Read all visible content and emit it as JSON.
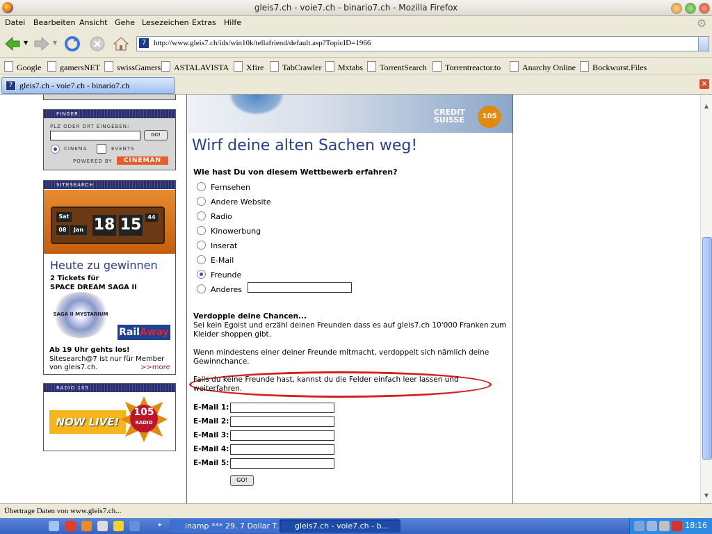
{
  "window": {
    "title": "gleis7.ch - voie7.ch - binario7.ch - Mozilla Firefox"
  },
  "menu": [
    "Datei",
    "Bearbeiten",
    "Ansicht",
    "Gehe",
    "Lesezeichen",
    "Extras",
    "Hilfe"
  ],
  "nav": {
    "url": "http://www.gleis7.ch/ids/win10k/tellafriend/default.asp?TopicID=1966",
    "favicon": "7"
  },
  "bookmarks": [
    "Google",
    "gamersNET",
    "swissGamers",
    "ASTALAVISTA",
    "Xfire",
    "TabCrawler",
    "Mxtabs",
    "TorrentSearch",
    "Torrentreactor.to",
    "Anarchy Online",
    "Bockwurst.Files"
  ],
  "tab": {
    "label": "gleis7.ch - voie7.ch - binario7.ch",
    "favicon": "7"
  },
  "sidebar": {
    "finder": {
      "header": "FINDER",
      "prompt": "PLZ ODER ORT EINGEBEN:",
      "go": "GO!",
      "cinema": "CINEMA",
      "events": "EVENTS",
      "powered": "POWERED BY",
      "brand": "CINEMAN"
    },
    "sitesearch": {
      "header": "SITESEARCH",
      "day": "Sat",
      "date": "08",
      "month": "Jan",
      "hour": "18",
      "minute": "15",
      "second": "44",
      "promo_title": "Heute zu gewinnen",
      "promo_line1": "2 Tickets für",
      "promo_line2": "SPACE DREAM SAGA II",
      "saga_label": "SAGA II MYSTARIUM",
      "railaway_rail": "Rail",
      "railaway_away": "Away",
      "note1": "Ab 19 Uhr gehts los!",
      "note2": "Sitesearch@7 ist nur für Member",
      "note3": "von gleis7.ch.",
      "more": ">>more"
    },
    "radio": {
      "header": "RADIO 105",
      "now_live": "NOW LIVE!",
      "badge": "105",
      "badge_sub": "RADIO"
    }
  },
  "main": {
    "banner": {
      "credit": "CREDIT",
      "suisse": "SUISSE",
      "badge": "105"
    },
    "headline": "Wirf deine alten Sachen weg!",
    "question": "Wie hast Du von diesem Wettbewerb erfahren?",
    "options": [
      "Fernsehen",
      "Andere Website",
      "Radio",
      "Kinowerbung",
      "Inserat",
      "E-Mail",
      "Freunde",
      "Anderes"
    ],
    "selected_option": "Freunde",
    "chances_title": "Verdopple deine Chancen...",
    "chances_text": "Sei kein Egoist und erzähl deinen Freunden dass es auf gleis7.ch 10'000 Franken zum Kleider shoppen gibt.",
    "double_text": "Wenn mindestens einer deiner Freunde mitmacht, verdoppelt sich nämlich deine Gewinnchance.",
    "no_friends_text": "Falls du keine Freunde hast, kannst du die Felder einfach leer lassen und weiterfahren.",
    "email_labels": [
      "E-Mail 1:",
      "E-Mail 2:",
      "E-Mail 3:",
      "E-Mail 4:",
      "E-Mail 5:"
    ],
    "submit": "GO!"
  },
  "status": "Übertrage Daten von www.gleis7.ch...",
  "taskbar": {
    "tasks": [
      "inamp *** 29. 7 Dollar T...",
      "gleis7.ch - voie7.ch - b..."
    ],
    "clock": "18:16"
  },
  "colors": {
    "accent": "#2c3d8c",
    "highlight_ring": "#d81e1e",
    "xp_blue": "#3563c2"
  }
}
